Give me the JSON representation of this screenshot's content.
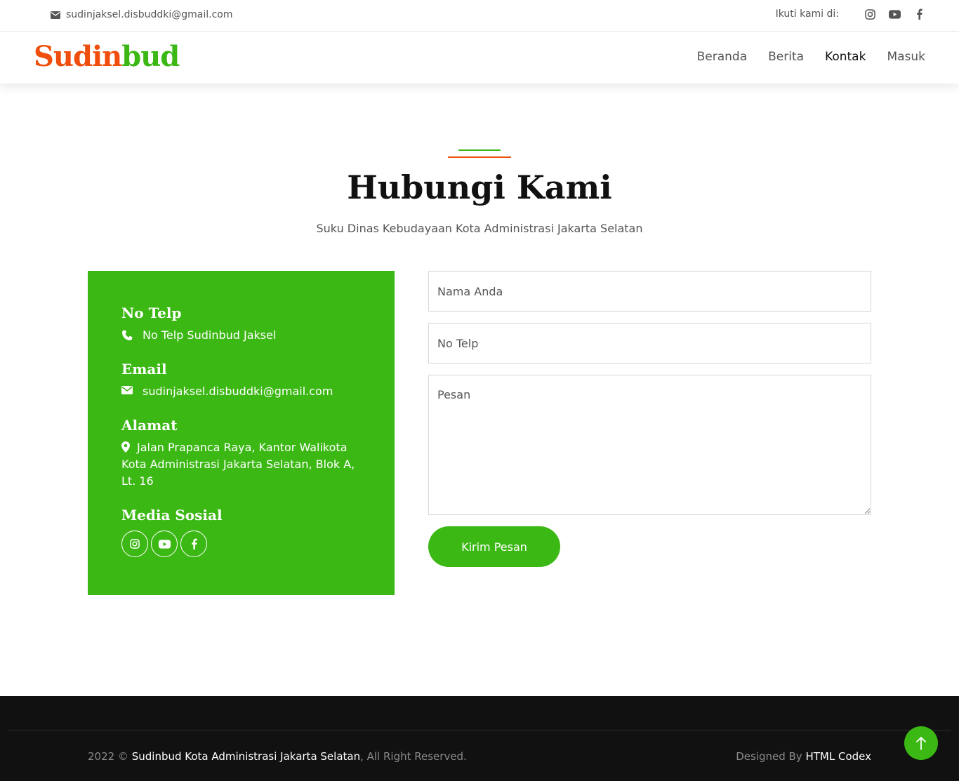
{
  "topbar": {
    "email": "sudinjaksel.disbuddki@gmail.com",
    "follow_label": "Ikuti kami di:"
  },
  "brand": {
    "part1": "Sudin",
    "part2": "bud"
  },
  "nav": [
    {
      "label": "Beranda"
    },
    {
      "label": "Berita"
    },
    {
      "label": "Kontak"
    },
    {
      "label": "Masuk"
    }
  ],
  "heading": {
    "title": "Hubungi Kami",
    "subtitle": "Suku Dinas Kebudayaan Kota Administrasi Jakarta Selatan"
  },
  "info": {
    "phone_title": "No Telp",
    "phone_value": "No Telp Sudinbud Jaksel",
    "email_title": "Email",
    "email_value": "sudinjaksel.disbuddki@gmail.com",
    "address_title": "Alamat",
    "address_value": "Jalan Prapanca Raya, Kantor Walikota Kota Administrasi Jakarta Selatan, Blok A, Lt. 16",
    "social_title": "Media Sosial"
  },
  "form": {
    "name_placeholder": "Nama Anda",
    "phone_placeholder": "No Telp",
    "message_placeholder": "Pesan",
    "submit_label": "Kirim Pesan"
  },
  "footer": {
    "year_prefix": "2022 ©",
    "org_link": "Sudinbud Kota Administrasi Jakarta Selatan",
    "rights": ", All Right Reserved.",
    "designed_prefix": "Designed By",
    "designer_link": "HTML Codex"
  },
  "colors": {
    "primary_green": "#3cb815",
    "accent_orange": "#f04e0c",
    "footer_bg": "#111111"
  },
  "icons": [
    "envelope-icon",
    "instagram-icon",
    "youtube-icon",
    "facebook-icon",
    "phone-icon",
    "map-marker-icon",
    "arrow-up-icon"
  ]
}
